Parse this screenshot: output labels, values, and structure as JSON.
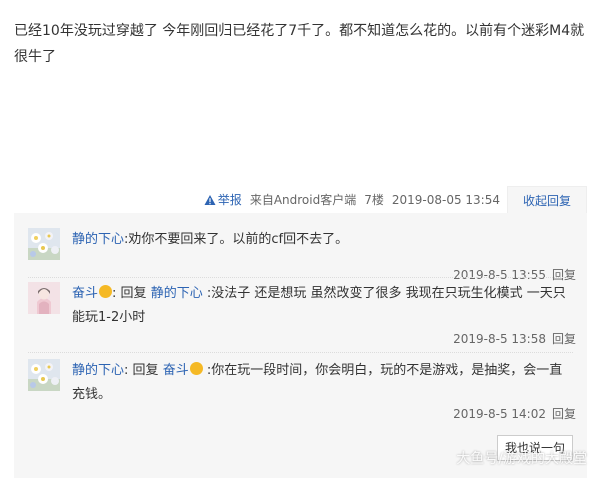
{
  "post": {
    "text": "已经10年没玩过穿越了 今年刚回归已经花了7千了。都不知道怎么花的。以前有个迷彩M4就很牛了"
  },
  "meta": {
    "report_label": "举报",
    "source": "来自Android客户端",
    "floor": "7楼",
    "datetime": "2019-08-05 13:54",
    "collapse_label": "收起回复"
  },
  "replies": [
    {
      "username": "静的下心",
      "colon": ":",
      "reply_word": "",
      "target_user": "",
      "text": "劝你不要回来了。以前的cf回不去了。",
      "time": "2019-8-5 13:55",
      "reply_btn": "回复"
    },
    {
      "username": "奋斗",
      "colon": ":",
      "reply_word": "回复",
      "target_user": "静的下心",
      "text": "没法子 还是想玩 虽然改变了很多 我现在只玩生化模式 一天只能玩1-2小时",
      "time": "2019-8-5 13:58",
      "reply_btn": "回复"
    },
    {
      "username": "静的下心",
      "colon": ":",
      "reply_word": "回复",
      "target_user": "奋斗",
      "text": "你在玩一段时间，你会明白，玩的不是游戏，是抽奖，会一直充钱。",
      "time": "2019-8-5 14:02",
      "reply_btn": "回复"
    }
  ],
  "say_button": "我也说一句",
  "watermark": "大鱼号/游戏的大殿堂",
  "colors": {
    "link": "#2d64b3",
    "reply_bg": "#f6f6f6",
    "meta_text": "#666666"
  },
  "icons": [
    "warning-icon",
    "avatar-flowers",
    "avatar-pink",
    "smile-emoji"
  ]
}
